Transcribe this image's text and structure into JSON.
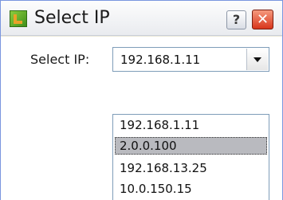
{
  "window": {
    "title": "Select IP",
    "help_label": "?",
    "close_label": "✕"
  },
  "form": {
    "label": "Select IP:",
    "selected_value": "192.168.1.11"
  },
  "dropdown": {
    "options": [
      "192.168.1.11",
      "2.0.0.100",
      "192.168.13.25",
      "10.0.150.15"
    ],
    "highlighted_index": 1
  },
  "icons": {
    "app": "app-logo-icon",
    "dropdown": "chevron-down-icon"
  }
}
